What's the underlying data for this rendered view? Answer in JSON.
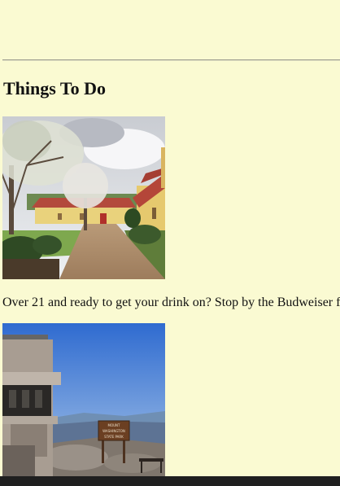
{
  "section": {
    "heading": "Things To Do"
  },
  "items": [
    {
      "photo": "courtyard-photo",
      "caption": "Over 21 and ready to get your drink on? Stop by the Budweiser f"
    },
    {
      "photo": "mountain-summit-photo",
      "sign_text": [
        "MOUNT",
        "WASHINGTON",
        "STATE PARK"
      ]
    }
  ],
  "colors": {
    "page_background": "#fafad2",
    "bottom_bar": "#1f1f1f"
  }
}
